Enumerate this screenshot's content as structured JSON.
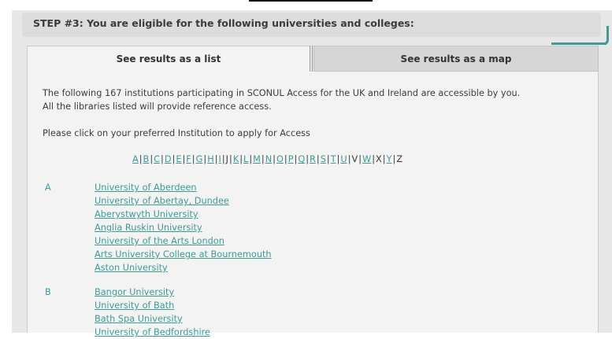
{
  "step": {
    "title": "STEP #3: You are eligible for the following universities and colleges:"
  },
  "tabs": {
    "list_label": "See results as a list",
    "map_label": "See results as a map"
  },
  "intro": {
    "line1": "The following 167 institutions participating in SCONUL Access for the UK and Ireland are accessible by you.",
    "line2": "All the libraries listed will provide reference access.",
    "instruction": "Please click on your preferred Institution to apply for Access"
  },
  "alphabet": [
    {
      "letter": "A",
      "link": true
    },
    {
      "letter": "B",
      "link": true
    },
    {
      "letter": "C",
      "link": true
    },
    {
      "letter": "D",
      "link": true
    },
    {
      "letter": "E",
      "link": true
    },
    {
      "letter": "F",
      "link": true
    },
    {
      "letter": "G",
      "link": true
    },
    {
      "letter": "H",
      "link": true
    },
    {
      "letter": "I",
      "link": true
    },
    {
      "letter": "J",
      "link": false
    },
    {
      "letter": "K",
      "link": true
    },
    {
      "letter": "L",
      "link": true
    },
    {
      "letter": "M",
      "link": true
    },
    {
      "letter": "N",
      "link": true
    },
    {
      "letter": "O",
      "link": true
    },
    {
      "letter": "P",
      "link": true
    },
    {
      "letter": "Q",
      "link": true
    },
    {
      "letter": "R",
      "link": true
    },
    {
      "letter": "S",
      "link": true
    },
    {
      "letter": "T",
      "link": true
    },
    {
      "letter": "U",
      "link": true
    },
    {
      "letter": "V",
      "link": false
    },
    {
      "letter": "W",
      "link": true
    },
    {
      "letter": "X",
      "link": false
    },
    {
      "letter": "Y",
      "link": true
    },
    {
      "letter": "Z",
      "link": false
    }
  ],
  "groups": [
    {
      "letter": "A",
      "institutions": [
        "University of Aberdeen",
        "University of Abertay, Dundee",
        "Aberystwyth University",
        "Anglia Ruskin University",
        "University of the Arts London",
        "Arts University College at Bournemouth",
        "Aston University"
      ]
    },
    {
      "letter": "B",
      "institutions": [
        "Bangor University",
        "University of Bath",
        "Bath Spa University",
        "University of Bedfordshire"
      ]
    }
  ],
  "colors": {
    "link": "#3b9c96",
    "accent_tab": "#3f9a99"
  }
}
